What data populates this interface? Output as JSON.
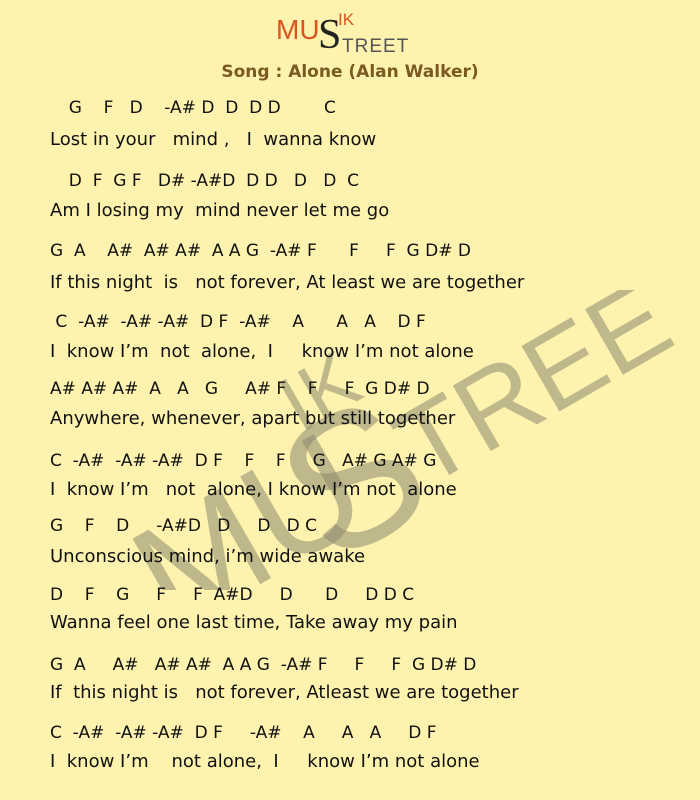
{
  "logo": {
    "mu": "MU",
    "ik": "IK",
    "s": "S",
    "treet": "TREET"
  },
  "song_title": "Song : Alone (Alan Walker)",
  "watermark": {
    "mu": "MU",
    "ik": "IK",
    "s": "S",
    "treet": "TREET"
  },
  "lines": [
    {
      "chords": "  G    F   D    -A# D  D  D D        C",
      "lyrics": "Lost in your   mind ,   I  wanna know"
    },
    {
      "chords": "  D  F  G F   D# -A#D  D D   D   D  C",
      "lyrics": "Am I losing my  mind never let me go"
    },
    {
      "chords": "G  A    A#  A# A#  A A G  -A# F      F     F  G D# D",
      "lyrics": "If this night  is   not forever, At least we are together"
    },
    {
      "chords": " C  -A#  -A# -A#  D F  -A#    A      A   A    D F",
      "lyrics": "I  know I’m  not  alone,  I     know I’m not alone"
    },
    {
      "chords": "A# A# A#  A   A   G     A# F    F     F  G D# D",
      "lyrics": "Anywhere, whenever, apart but still together"
    },
    {
      "chords": "C  -A#  -A# -A#  D F    F    F     G   A# G A# G",
      "lyrics": "I  know I’m   not  alone, I know I’m not  alone"
    },
    {
      "chords": "G    F    D     -A#D   D     D   D C",
      "lyrics": "Unconscious mind, i’m wide awake"
    },
    {
      "chords": "D    F    G     F     F  A#D     D      D     D D C",
      "lyrics": "Wanna feel one last time, Take away my pain"
    },
    {
      "chords": "G  A     A#   A# A#  A A G  -A# F     F     F  G D# D",
      "lyrics": "If  this night is   not forever, Atleast we are together"
    },
    {
      "chords": "C  -A#  -A# -A#  D F     -A#    A     A   A     D F",
      "lyrics": "I  know I’m    not alone,  I     know I’m not alone"
    }
  ]
}
